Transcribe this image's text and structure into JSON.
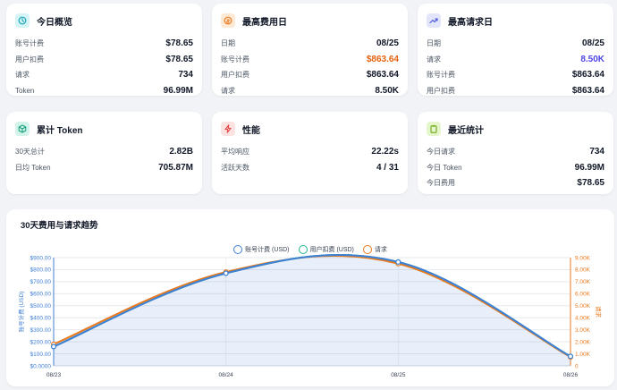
{
  "cards": [
    {
      "title": "今日概览",
      "icon": "clock-icon",
      "icon_bg": "#d6f4f6",
      "icon_color": "#1aa5b8",
      "rows": [
        {
          "label": "账号计费",
          "value": "$78.65"
        },
        {
          "label": "用户扣费",
          "value": "$78.65"
        },
        {
          "label": "请求",
          "value": "734"
        },
        {
          "label": "Token",
          "value": "96.99M"
        }
      ]
    },
    {
      "title": "最高费用日",
      "icon": "coin-icon",
      "icon_bg": "#fde9d4",
      "icon_color": "#ea7a1e",
      "rows": [
        {
          "label": "日期",
          "value": "08/25"
        },
        {
          "label": "账号计费",
          "value": "$863.64",
          "color": "#e4610f"
        },
        {
          "label": "用户扣费",
          "value": "$863.64"
        },
        {
          "label": "请求",
          "value": "8.50K"
        }
      ]
    },
    {
      "title": "最高请求日",
      "icon": "trend-up-icon",
      "icon_bg": "#e3e6fb",
      "icon_color": "#4c55d6",
      "rows": [
        {
          "label": "日期",
          "value": "08/25"
        },
        {
          "label": "请求",
          "value": "8.50K",
          "color": "#4f46e5"
        },
        {
          "label": "账号计费",
          "value": "$863.64"
        },
        {
          "label": "用户扣费",
          "value": "$863.64"
        }
      ]
    },
    {
      "title": "累计 Token",
      "icon": "cube-icon",
      "icon_bg": "#d3f3ea",
      "icon_color": "#17a07c",
      "rows": [
        {
          "label": "30天总计",
          "value": "2.82B"
        },
        {
          "label": "日均 Token",
          "value": "705.87M"
        }
      ]
    },
    {
      "title": "性能",
      "icon": "lightning-icon",
      "icon_bg": "#fde2e2",
      "icon_color": "#e13b3b",
      "rows": [
        {
          "label": "平均响应",
          "value": "22.22s"
        },
        {
          "label": "活跃天数",
          "value": "4 / 31"
        }
      ]
    },
    {
      "title": "最近统计",
      "icon": "clipboard-icon",
      "icon_bg": "#e5f6cc",
      "icon_color": "#6ea816",
      "rows": [
        {
          "label": "今日请求",
          "value": "734"
        },
        {
          "label": "今日 Token",
          "value": "96.99M"
        },
        {
          "label": "今日费用",
          "value": "$78.65"
        }
      ]
    }
  ],
  "chart_title": "30天费用与请求趋势",
  "chart_data": {
    "type": "line",
    "categories": [
      "08/23",
      "08/24",
      "08/25",
      "08/26"
    ],
    "series": [
      {
        "name": "账号计费 (USD)",
        "axis": "left",
        "color": "#3f7fd6",
        "values": [
          160,
          770,
          863.64,
          78.65
        ]
      },
      {
        "name": "用户扣费 (USD)",
        "axis": "left",
        "color": "#20b58f",
        "values": [
          160,
          770,
          863.64,
          78.65
        ]
      },
      {
        "name": "请求",
        "axis": "right",
        "color": "#ea7a1e",
        "values": [
          1800,
          7800,
          8500,
          734
        ]
      }
    ],
    "y_left": {
      "label": "账号计费 (USD)",
      "min": 0,
      "max": 900,
      "ticks": [
        "$0.0000",
        "$100.00",
        "$200.00",
        "$300.00",
        "$400.00",
        "$500.00",
        "$600.00",
        "$700.00",
        "$800.00",
        "$900.00"
      ]
    },
    "y_right": {
      "label": "请求",
      "min": 0,
      "max": 9000,
      "ticks": [
        "0",
        "1.00K",
        "2.00K",
        "3.00K",
        "4.00K",
        "5.00K",
        "6.00K",
        "7.00K",
        "8.00K",
        "9.00K"
      ]
    },
    "legend_position": "top-center",
    "grid": true,
    "area_fill": true
  }
}
